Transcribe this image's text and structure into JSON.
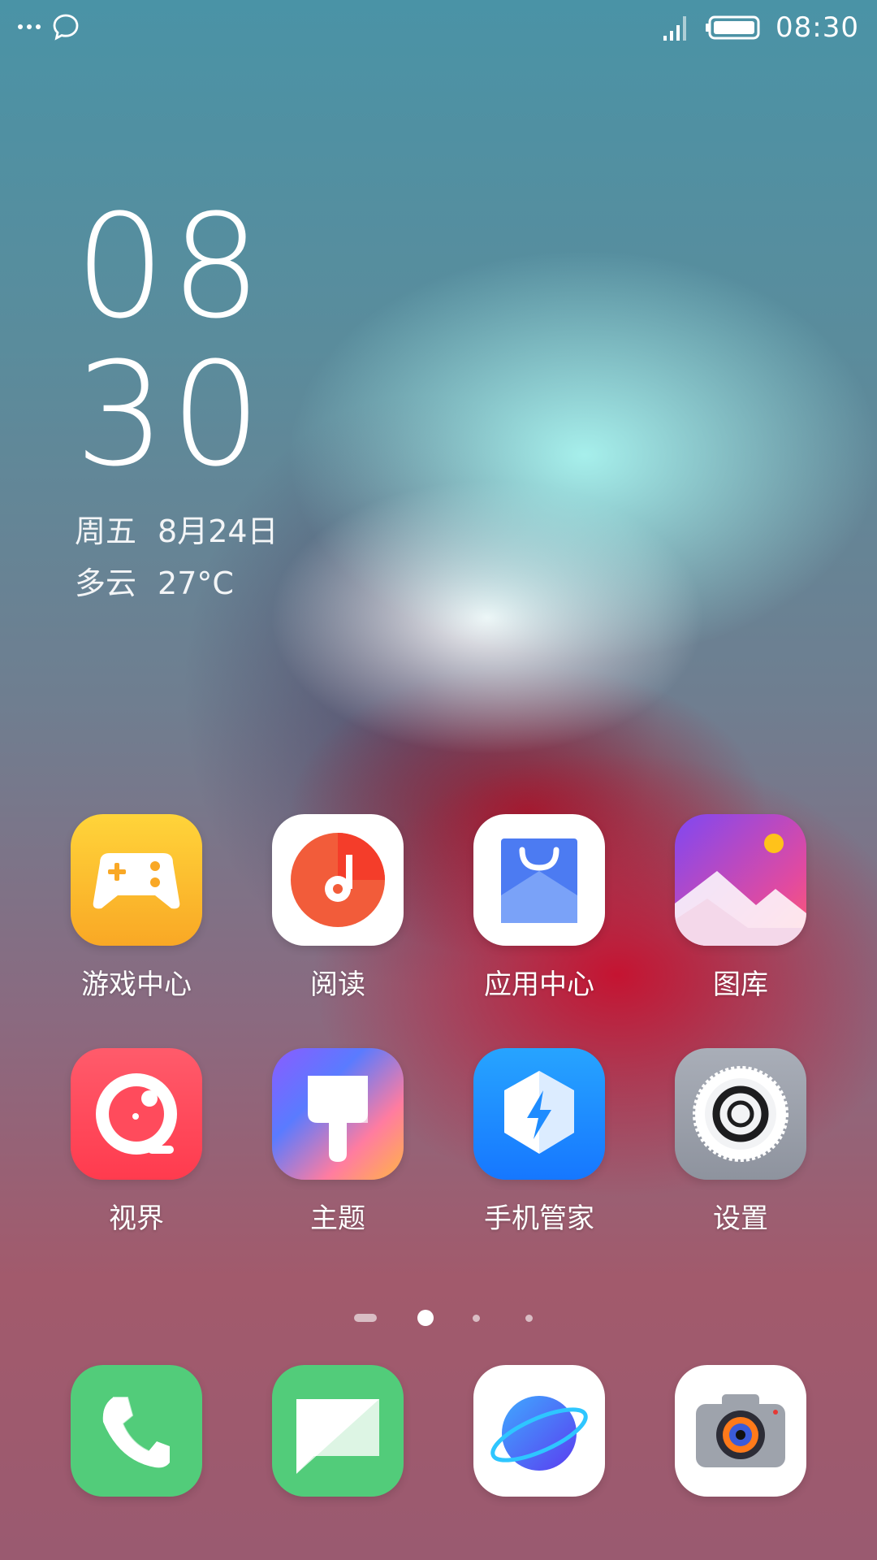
{
  "status_bar": {
    "time": "08:30",
    "left_icons": [
      "more-dots-icon",
      "message-bubble-icon"
    ],
    "right_icons": [
      "signal-icon",
      "battery-icon"
    ]
  },
  "clock_widget": {
    "hour": "08",
    "minute": "30",
    "weekday": "周五",
    "date": "8月24日",
    "weather": "多云",
    "temperature": "27°C"
  },
  "apps": [
    {
      "label": "游戏中心",
      "icon": "gamepad-icon"
    },
    {
      "label": "阅读",
      "icon": "reading-icon"
    },
    {
      "label": "应用中心",
      "icon": "app-store-bag-icon"
    },
    {
      "label": "图库",
      "icon": "gallery-icon"
    },
    {
      "label": "视界",
      "icon": "video-lens-icon"
    },
    {
      "label": "主题",
      "icon": "theme-brush-icon"
    },
    {
      "label": "手机管家",
      "icon": "phone-manager-shield-icon"
    },
    {
      "label": "设置",
      "icon": "settings-gear-icon"
    }
  ],
  "pager": {
    "current_page": 2,
    "total_pages": 4
  },
  "dock": [
    {
      "icon": "phone-icon"
    },
    {
      "icon": "messages-icon"
    },
    {
      "icon": "browser-planet-icon"
    },
    {
      "icon": "camera-icon"
    }
  ],
  "colors": {
    "game_yellow": "#FDB92A",
    "music_red": "#F04A2E",
    "store_blue": "#4C7BF2",
    "gallery_purple": "#8A4BF0",
    "video_red": "#FF4B5C",
    "phone_green": "#4CCB75",
    "manager_blue": "#1E8CFF"
  }
}
